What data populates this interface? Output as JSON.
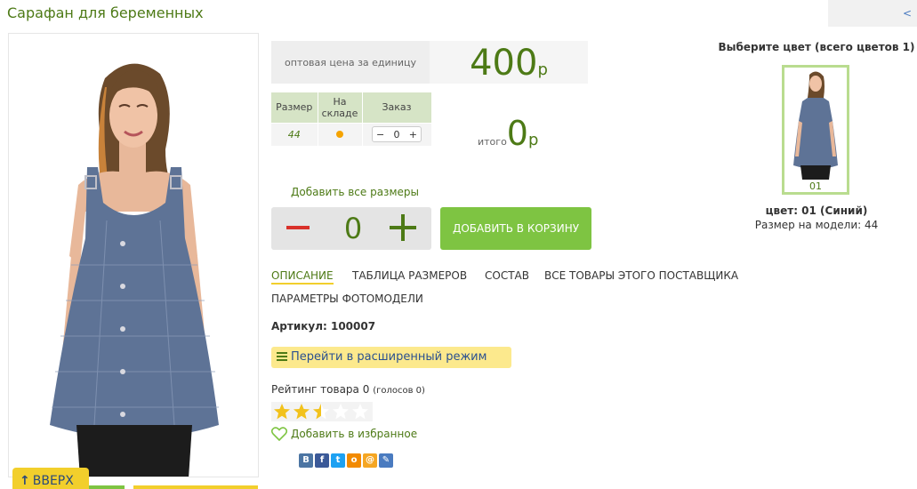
{
  "product": {
    "title": "Сарафан для беременных",
    "back_label": "<"
  },
  "price": {
    "label": "оптовая цена за единицу",
    "value": "400",
    "currency": "р"
  },
  "sizes_table": {
    "headers": [
      "Размер",
      "На складе",
      "Заказ"
    ],
    "rows": [
      {
        "size": "44",
        "qty": "0"
      }
    ]
  },
  "total": {
    "label": "итого",
    "value": "0",
    "currency": "р"
  },
  "add_all_sizes": "Добавить все размеры",
  "stepper": {
    "quantity": "0"
  },
  "cart_button": "ДОБАВИТЬ В КОРЗИНУ",
  "tabs": [
    "ОПИСАНИЕ",
    "ТАБЛИЦА РАЗМЕРОВ",
    "СОСТАВ",
    "ВСЕ ТОВАРЫ ЭТОГО ПОСТАВЩИКА",
    "ПАРАМЕТРЫ ФОТОМОДЕЛИ"
  ],
  "article": "Артикул: 100007",
  "advanced_mode": "Перейти в расширенный режим",
  "rating": {
    "label": "Рейтинг товара 0",
    "votes": "(голосов 0)",
    "stars_filled": 2.5,
    "stars_total": 5
  },
  "favorite": "Добавить в избранное",
  "share_icons": [
    "vk-icon",
    "facebook-icon",
    "twitter-icon",
    "odnoklassniki-icon",
    "mailru-icon",
    "livejournal-icon"
  ],
  "colors": {
    "title": "Выберите цвет (всего цветов 1)",
    "items": [
      {
        "code": "01"
      }
    ],
    "selected_name": "цвет: 01 (Синий)",
    "model_size": "Размер на модели: 44"
  },
  "scroll_up": "ВВЕРХ",
  "palette": {
    "accent_green": "#4d7a16",
    "button_green": "#7ec442",
    "yellow": "#f2cf2c",
    "minus_red": "#d9312a"
  }
}
